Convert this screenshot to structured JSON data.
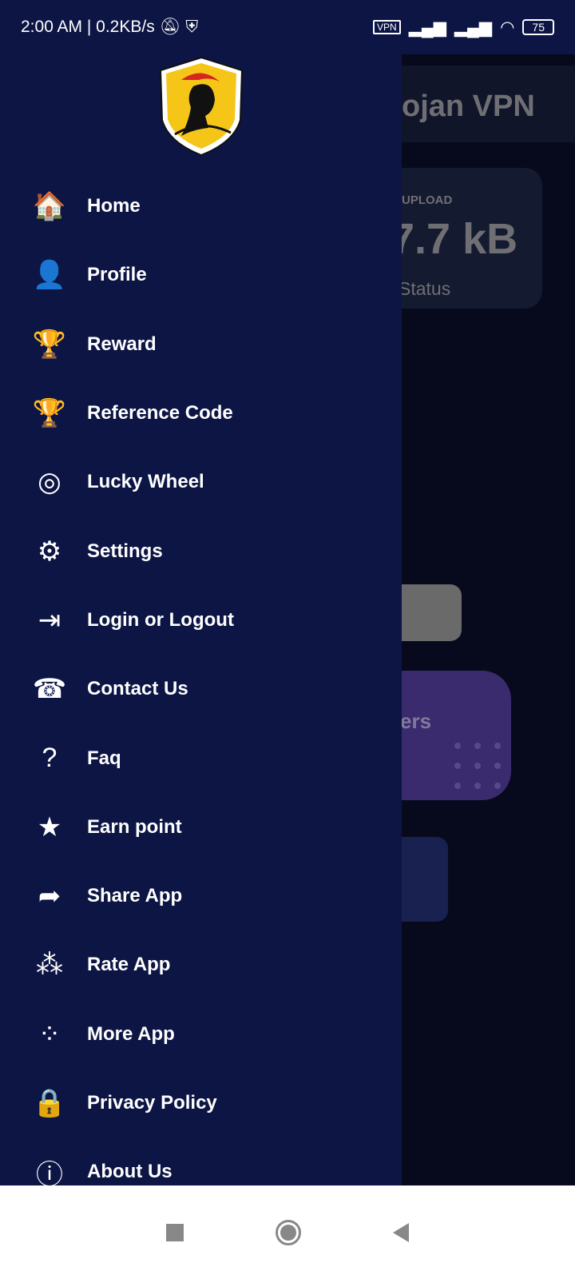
{
  "status_bar": {
    "time": "2:00 AM | 0.2KB/s",
    "vpn": "VPN",
    "battery": "75"
  },
  "background": {
    "title": "ojan VPN",
    "upload_label": "UPLOAD",
    "upload_value": "7.7 kB",
    "status": "Status",
    "servers": "ers"
  },
  "drawer": {
    "logo": "Trojan shield logo",
    "items": [
      {
        "label": "Home",
        "icon": "home-icon",
        "glyph": "🏠"
      },
      {
        "label": "Profile",
        "icon": "user-icon",
        "glyph": "👤"
      },
      {
        "label": "Reward",
        "icon": "trophy-icon",
        "glyph": "🏆"
      },
      {
        "label": "Reference Code",
        "icon": "trophy-icon",
        "glyph": "🏆"
      },
      {
        "label": "Lucky Wheel",
        "icon": "wheel-icon",
        "glyph": "◎"
      },
      {
        "label": "Settings",
        "icon": "gear-icon",
        "glyph": "⚙"
      },
      {
        "label": "Login or Logout",
        "icon": "login-door-icon",
        "glyph": "⇥"
      },
      {
        "label": "Contact Us",
        "icon": "support-agent-icon",
        "glyph": "☎"
      },
      {
        "label": "Faq",
        "icon": "question-chat-icon",
        "glyph": "?"
      },
      {
        "label": "Earn point",
        "icon": "star-card-icon",
        "glyph": "★"
      },
      {
        "label": "Share App",
        "icon": "share-arrow-icon",
        "glyph": "➦"
      },
      {
        "label": "Rate App",
        "icon": "rate-stars-icon",
        "glyph": "⁂"
      },
      {
        "label": "More App",
        "icon": "more-dots-icon",
        "glyph": "⁘"
      },
      {
        "label": "Privacy Policy",
        "icon": "privacy-doc-icon",
        "glyph": "🔒"
      },
      {
        "label": "About Us",
        "icon": "about-doc-icon",
        "glyph": "ⓘ"
      }
    ]
  },
  "colors": {
    "drawer": "#0c1544",
    "scrim": "#060a1c",
    "logo_yellow": "#f5c518",
    "logo_red": "#d6261e"
  }
}
